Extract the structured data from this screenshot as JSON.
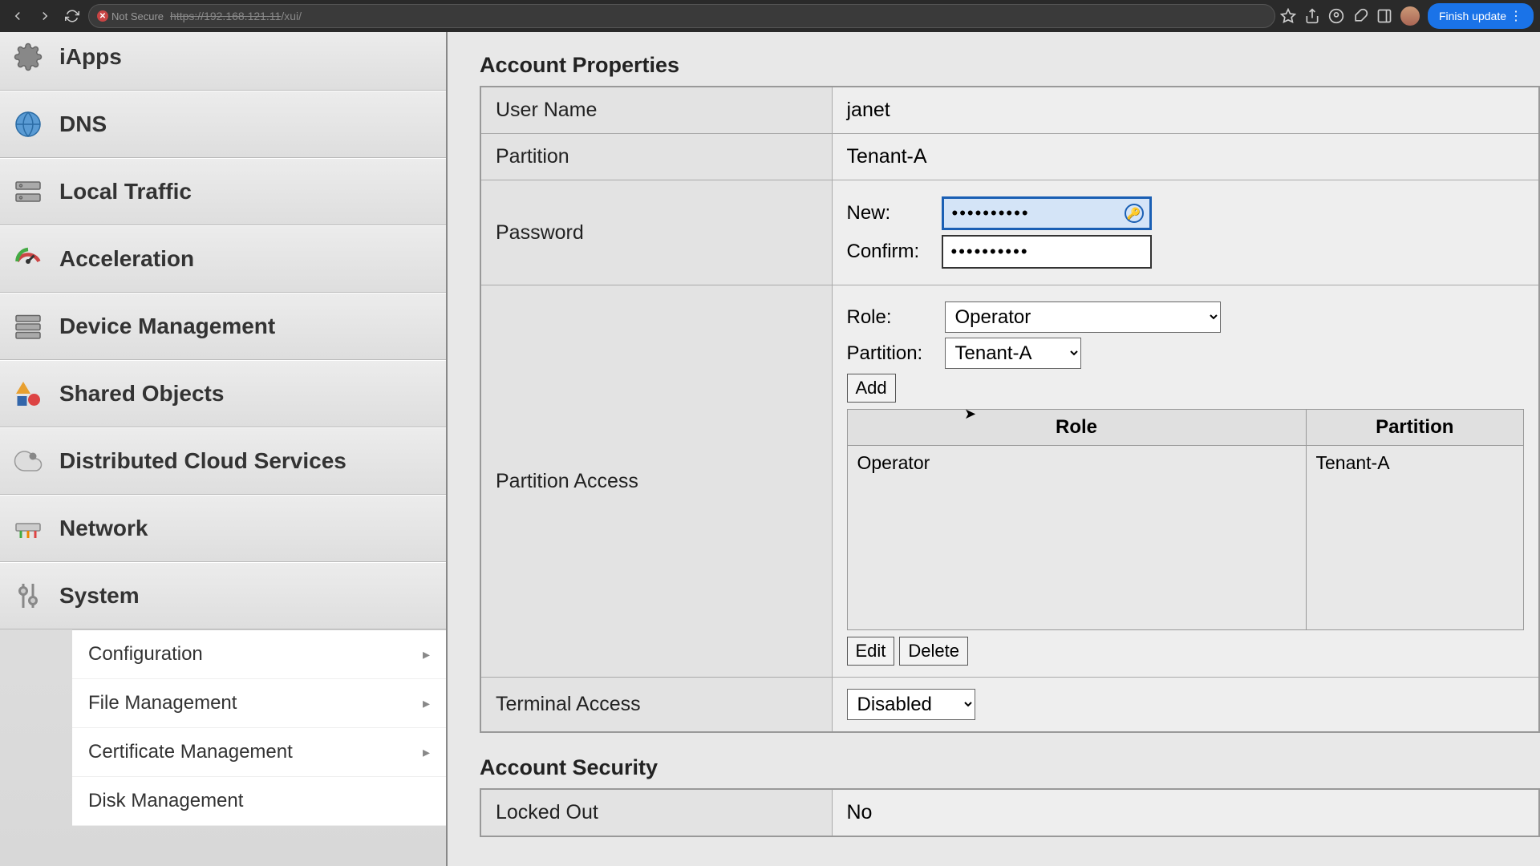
{
  "browser": {
    "not_secure": "Not Secure",
    "url_host": "https://192.168.121.11",
    "url_path": "/xui/",
    "finish_update": "Finish update"
  },
  "sidebar": {
    "items": [
      {
        "label": "iApps"
      },
      {
        "label": "DNS"
      },
      {
        "label": "Local Traffic"
      },
      {
        "label": "Acceleration"
      },
      {
        "label": "Device Management"
      },
      {
        "label": "Shared Objects"
      },
      {
        "label": "Distributed Cloud Services"
      },
      {
        "label": "Network"
      },
      {
        "label": "System"
      }
    ],
    "system_sub": [
      {
        "label": "Configuration"
      },
      {
        "label": "File Management"
      },
      {
        "label": "Certificate Management"
      },
      {
        "label": "Disk Management"
      }
    ]
  },
  "account": {
    "section_props": "Account Properties",
    "labels": {
      "user_name": "User Name",
      "partition": "Partition",
      "password": "Password",
      "partition_access": "Partition Access",
      "terminal_access": "Terminal Access"
    },
    "values": {
      "user_name": "janet",
      "partition": "Tenant-A",
      "pw_new_label": "New:",
      "pw_confirm_label": "Confirm:",
      "pw_new_value": "••••••••••",
      "pw_confirm_value": "••••••••••",
      "role_label": "Role:",
      "role_selected": "Operator",
      "part_label": "Partition:",
      "part_selected": "Tenant-A",
      "add_btn": "Add",
      "edit_btn": "Edit",
      "delete_btn": "Delete",
      "col_role": "Role",
      "col_partition": "Partition",
      "row_role": "Operator",
      "row_partition": "Tenant-A",
      "terminal_selected": "Disabled"
    },
    "section_security": "Account Security",
    "security_labels": {
      "locked_out": "Locked Out"
    },
    "security_values": {
      "locked_out": "No"
    }
  }
}
